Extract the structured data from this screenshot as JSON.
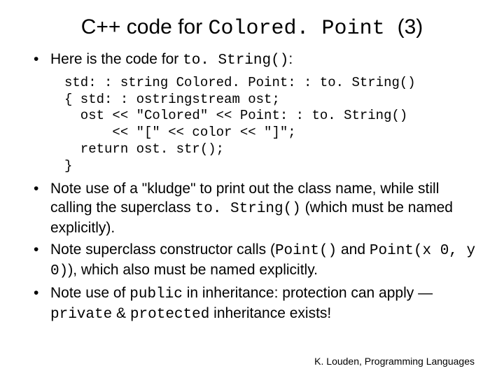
{
  "title": {
    "pre": "C++ code for ",
    "mono": "Colored. Point ",
    "post": "(3)"
  },
  "bullets": {
    "b1": {
      "pre": "Here is the code for ",
      "mono": "to. String()",
      "post": ":"
    },
    "code": "std: : string Colored. Point: : to. String()\n{ std: : ostringstream ost;\n  ost << \"Colored\" << Point: : to. String()\n      << \"[\" << color << \"]\";\n  return ost. str();\n}",
    "b2": {
      "t1": "Note use of a \"kludge\" to print out the class name, while still calling the superclass ",
      "mono1": "to. String()",
      "t2": " (which must be named explicitly)."
    },
    "b3": {
      "t1": "Note superclass constructor calls (",
      "mono1": "Point()",
      "t2": " and ",
      "mono2": "Point(x 0, y 0)",
      "t3": "), which also must be named explicitly."
    },
    "b4": {
      "t1": "Note use of ",
      "mono1": "public",
      "t2": " in inheritance: protection can apply —",
      "mono2": "private",
      "t3": " & ",
      "mono3": "protected",
      "t4": " inheritance exists!"
    }
  },
  "footer": "K. Louden, Programming Languages"
}
